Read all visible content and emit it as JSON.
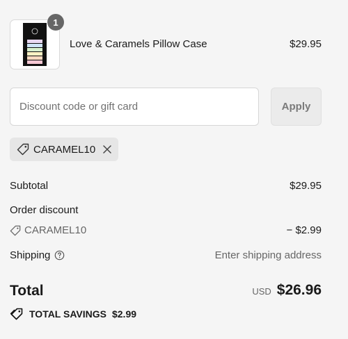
{
  "cart": {
    "item": {
      "quantity": "1",
      "name": "Love & Caramels Pillow Case",
      "price": "$29.95"
    }
  },
  "discount": {
    "placeholder": "Discount code or gift card",
    "apply_label": "Apply",
    "applied_code": "CARAMEL10"
  },
  "summary": {
    "subtotal_label": "Subtotal",
    "subtotal_value": "$29.95",
    "order_discount_label": "Order discount",
    "discount_code": "CARAMEL10",
    "discount_value": "− $2.99",
    "shipping_label": "Shipping",
    "shipping_value": "Enter shipping address",
    "total_label": "Total",
    "currency": "USD",
    "total_value": "$26.96",
    "savings_label": "TOTAL SAVINGS",
    "savings_value": "$2.99"
  },
  "icons": {
    "tag": "tag-icon",
    "close": "close-icon",
    "help": "question-circle-icon"
  },
  "colors": {
    "background": "#f5f5f5",
    "badge": "#666666",
    "apply_bg": "#ebebeb",
    "chip_bg": "#e6e6e6"
  }
}
